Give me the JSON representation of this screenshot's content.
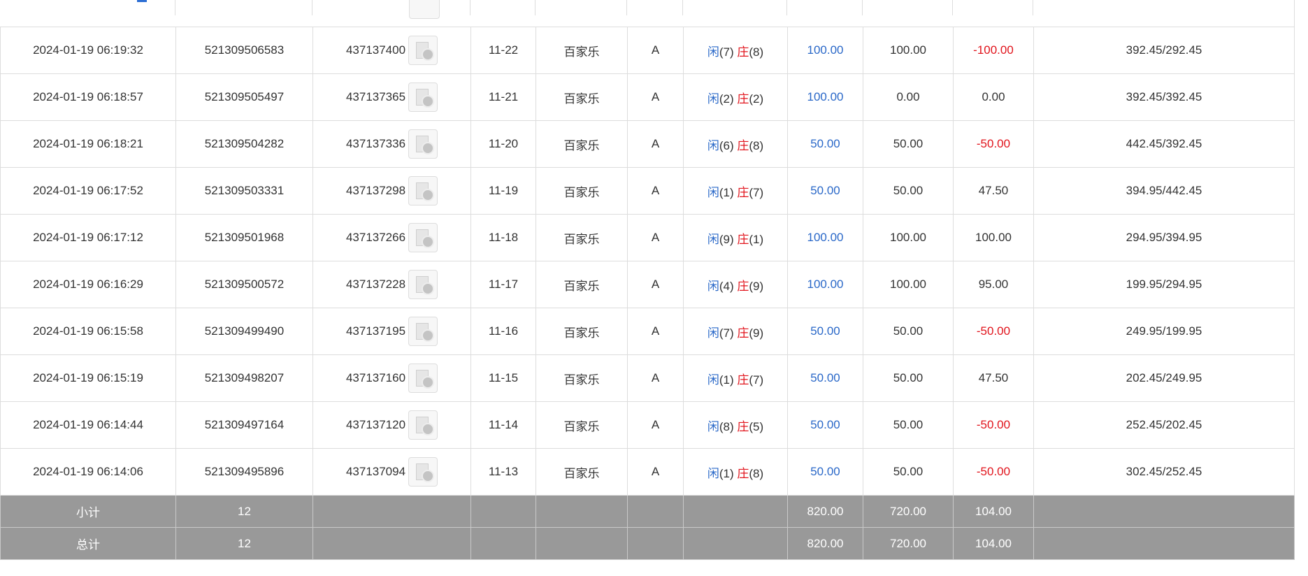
{
  "table": {
    "rows": [
      {
        "time": "2024-01-19 06:19:32",
        "bet_id": "521309506583",
        "round_id": "437137400",
        "shoe": "11-22",
        "game": "百家乐",
        "table": "A",
        "player_label": "闲",
        "player_pts": "(7)",
        "banker_label": "庄",
        "banker_pts": "(8)",
        "bet": "100.00",
        "valid": "100.00",
        "win": "-100.00",
        "win_negative": true,
        "balance": "392.45/292.45"
      },
      {
        "time": "2024-01-19 06:18:57",
        "bet_id": "521309505497",
        "round_id": "437137365",
        "shoe": "11-21",
        "game": "百家乐",
        "table": "A",
        "player_label": "闲",
        "player_pts": "(2)",
        "banker_label": "庄",
        "banker_pts": "(2)",
        "bet": "100.00",
        "valid": "0.00",
        "win": "0.00",
        "win_negative": false,
        "balance": "392.45/392.45"
      },
      {
        "time": "2024-01-19 06:18:21",
        "bet_id": "521309504282",
        "round_id": "437137336",
        "shoe": "11-20",
        "game": "百家乐",
        "table": "A",
        "player_label": "闲",
        "player_pts": "(6)",
        "banker_label": "庄",
        "banker_pts": "(8)",
        "bet": "50.00",
        "valid": "50.00",
        "win": "-50.00",
        "win_negative": true,
        "balance": "442.45/392.45"
      },
      {
        "time": "2024-01-19 06:17:52",
        "bet_id": "521309503331",
        "round_id": "437137298",
        "shoe": "11-19",
        "game": "百家乐",
        "table": "A",
        "player_label": "闲",
        "player_pts": "(1)",
        "banker_label": "庄",
        "banker_pts": "(7)",
        "bet": "50.00",
        "valid": "50.00",
        "win": "47.50",
        "win_negative": false,
        "balance": "394.95/442.45"
      },
      {
        "time": "2024-01-19 06:17:12",
        "bet_id": "521309501968",
        "round_id": "437137266",
        "shoe": "11-18",
        "game": "百家乐",
        "table": "A",
        "player_label": "闲",
        "player_pts": "(9)",
        "banker_label": "庄",
        "banker_pts": "(1)",
        "bet": "100.00",
        "valid": "100.00",
        "win": "100.00",
        "win_negative": false,
        "balance": "294.95/394.95"
      },
      {
        "time": "2024-01-19 06:16:29",
        "bet_id": "521309500572",
        "round_id": "437137228",
        "shoe": "11-17",
        "game": "百家乐",
        "table": "A",
        "player_label": "闲",
        "player_pts": "(4)",
        "banker_label": "庄",
        "banker_pts": "(9)",
        "bet": "100.00",
        "valid": "100.00",
        "win": "95.00",
        "win_negative": false,
        "balance": "199.95/294.95"
      },
      {
        "time": "2024-01-19 06:15:58",
        "bet_id": "521309499490",
        "round_id": "437137195",
        "shoe": "11-16",
        "game": "百家乐",
        "table": "A",
        "player_label": "闲",
        "player_pts": "(7)",
        "banker_label": "庄",
        "banker_pts": "(9)",
        "bet": "50.00",
        "valid": "50.00",
        "win": "-50.00",
        "win_negative": true,
        "balance": "249.95/199.95"
      },
      {
        "time": "2024-01-19 06:15:19",
        "bet_id": "521309498207",
        "round_id": "437137160",
        "shoe": "11-15",
        "game": "百家乐",
        "table": "A",
        "player_label": "闲",
        "player_pts": "(1)",
        "banker_label": "庄",
        "banker_pts": "(7)",
        "bet": "50.00",
        "valid": "50.00",
        "win": "47.50",
        "win_negative": false,
        "balance": "202.45/249.95"
      },
      {
        "time": "2024-01-19 06:14:44",
        "bet_id": "521309497164",
        "round_id": "437137120",
        "shoe": "11-14",
        "game": "百家乐",
        "table": "A",
        "player_label": "闲",
        "player_pts": "(8)",
        "banker_label": "庄",
        "banker_pts": "(5)",
        "bet": "50.00",
        "valid": "50.00",
        "win": "-50.00",
        "win_negative": true,
        "balance": "252.45/202.45"
      },
      {
        "time": "2024-01-19 06:14:06",
        "bet_id": "521309495896",
        "round_id": "437137094",
        "shoe": "11-13",
        "game": "百家乐",
        "table": "A",
        "player_label": "闲",
        "player_pts": "(1)",
        "banker_label": "庄",
        "banker_pts": "(8)",
        "bet": "50.00",
        "valid": "50.00",
        "win": "-50.00",
        "win_negative": true,
        "balance": "302.45/252.45"
      }
    ],
    "subtotal": {
      "label": "小计",
      "count": "12",
      "bet": "820.00",
      "valid": "720.00",
      "win": "104.00"
    },
    "total": {
      "label": "总计",
      "count": "12",
      "bet": "820.00",
      "valid": "720.00",
      "win": "104.00"
    }
  },
  "icons": {
    "replay": "replay-video-icon"
  },
  "colors": {
    "player_blue": "#2a68c8",
    "banker_red": "#e1141c",
    "summary_bg": "#999999",
    "border": "#dddddd"
  }
}
